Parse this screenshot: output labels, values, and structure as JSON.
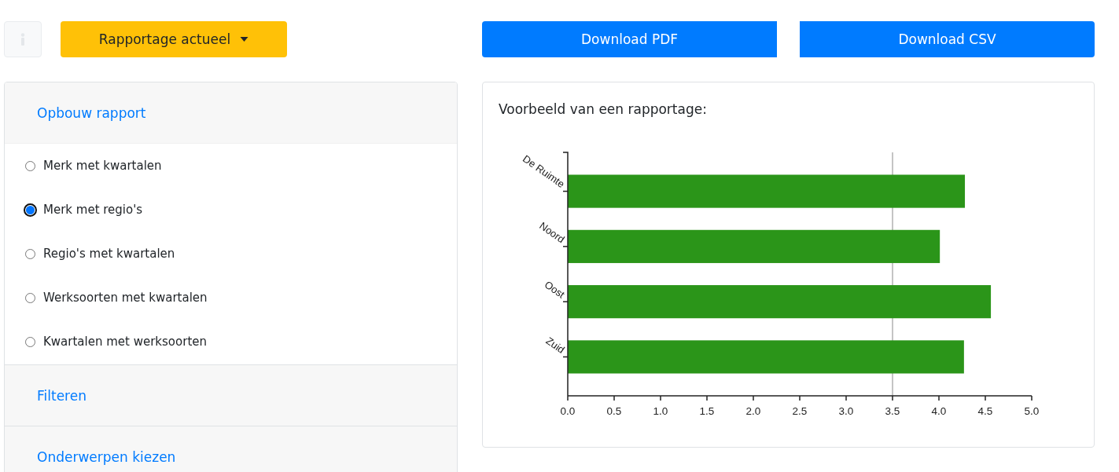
{
  "toolbar": {
    "report_dropdown": {
      "label": "Rapportage actueel"
    },
    "buttons": [
      {
        "label": "Download PDF"
      },
      {
        "label": "Download CSV"
      }
    ]
  },
  "sections": [
    {
      "title": "Opbouw rapport",
      "expanded": true,
      "options": [
        {
          "label": "Merk met kwartalen",
          "selected": false
        },
        {
          "label": "Merk met regio's",
          "selected": true
        },
        {
          "label": "Regio's met kwartalen",
          "selected": false
        },
        {
          "label": "Werksoorten met kwartalen",
          "selected": false
        },
        {
          "label": "Kwartalen met werksoorten",
          "selected": false
        }
      ]
    },
    {
      "title": "Filteren",
      "expanded": false
    },
    {
      "title": "Onderwerpen kiezen",
      "expanded": false
    }
  ],
  "preview": {
    "title": "Voorbeeld van een rapportage:",
    "chart_data": {
      "type": "bar",
      "orientation": "horizontal",
      "categories": [
        "De Ruimte",
        "Noord",
        "Oost",
        "Zuid"
      ],
      "series": [
        {
          "color": "#2b9519",
          "values": [
            4.28,
            4.01,
            4.56,
            4.27
          ]
        }
      ],
      "xlim": [
        0,
        5
      ],
      "xticks": [
        {
          "value": 0,
          "label": "0.0"
        },
        {
          "value": 0.5,
          "label": "0.5"
        },
        {
          "value": 1,
          "label": "1.0"
        },
        {
          "value": 1.5,
          "label": "1.5"
        },
        {
          "value": 2,
          "label": "2.0"
        },
        {
          "value": 2.5,
          "label": "2.5"
        },
        {
          "value": 3,
          "label": "3.0"
        },
        {
          "value": 3.5,
          "label": "3.5"
        },
        {
          "value": 4,
          "label": "4.0"
        },
        {
          "value": 4.5,
          "label": "4.5"
        },
        {
          "value": 5,
          "label": "5.0"
        }
      ],
      "ref_lines": [
        {
          "axis": "x",
          "value": 3.5
        }
      ]
    }
  }
}
